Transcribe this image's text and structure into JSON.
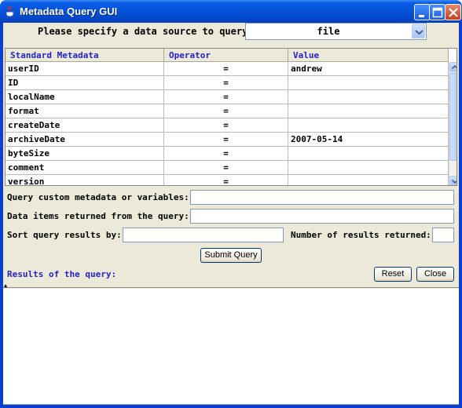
{
  "window": {
    "title": "Metadata Query GUI",
    "accent": "#0a5ee8",
    "icons": [
      "java-cup-icon",
      "minimize-icon",
      "maximize-icon",
      "close-icon"
    ]
  },
  "data_source": {
    "label": "Please specify a data source to query:",
    "selected": "file"
  },
  "table": {
    "headers": [
      "Standard Metadata",
      "Operator",
      "Value"
    ],
    "rows": [
      {
        "name": "userID",
        "op": "=",
        "value": "andrew"
      },
      {
        "name": "ID",
        "op": "=",
        "value": ""
      },
      {
        "name": "localName",
        "op": "=",
        "value": ""
      },
      {
        "name": "format",
        "op": "=",
        "value": ""
      },
      {
        "name": "createDate",
        "op": "=",
        "value": ""
      },
      {
        "name": "archiveDate",
        "op": "=",
        "value": "2007-05-14"
      },
      {
        "name": "byteSize",
        "op": "=",
        "value": ""
      },
      {
        "name": "comment",
        "op": "=",
        "value": ""
      },
      {
        "name": "version",
        "op": "=",
        "value": ""
      }
    ]
  },
  "form": {
    "custom_label": "Query custom metadata or variables:",
    "custom_value": "",
    "returned_label": "Data items returned from the query:",
    "returned_value": "",
    "sort_label": "Sort query results by:",
    "sort_value": "",
    "number_label": "Number of results returned:",
    "number_value": ""
  },
  "buttons": {
    "submit": "Submit Query",
    "reset": "Reset",
    "close": "Close"
  },
  "results": {
    "label": "Results of the query:",
    "content": ""
  }
}
